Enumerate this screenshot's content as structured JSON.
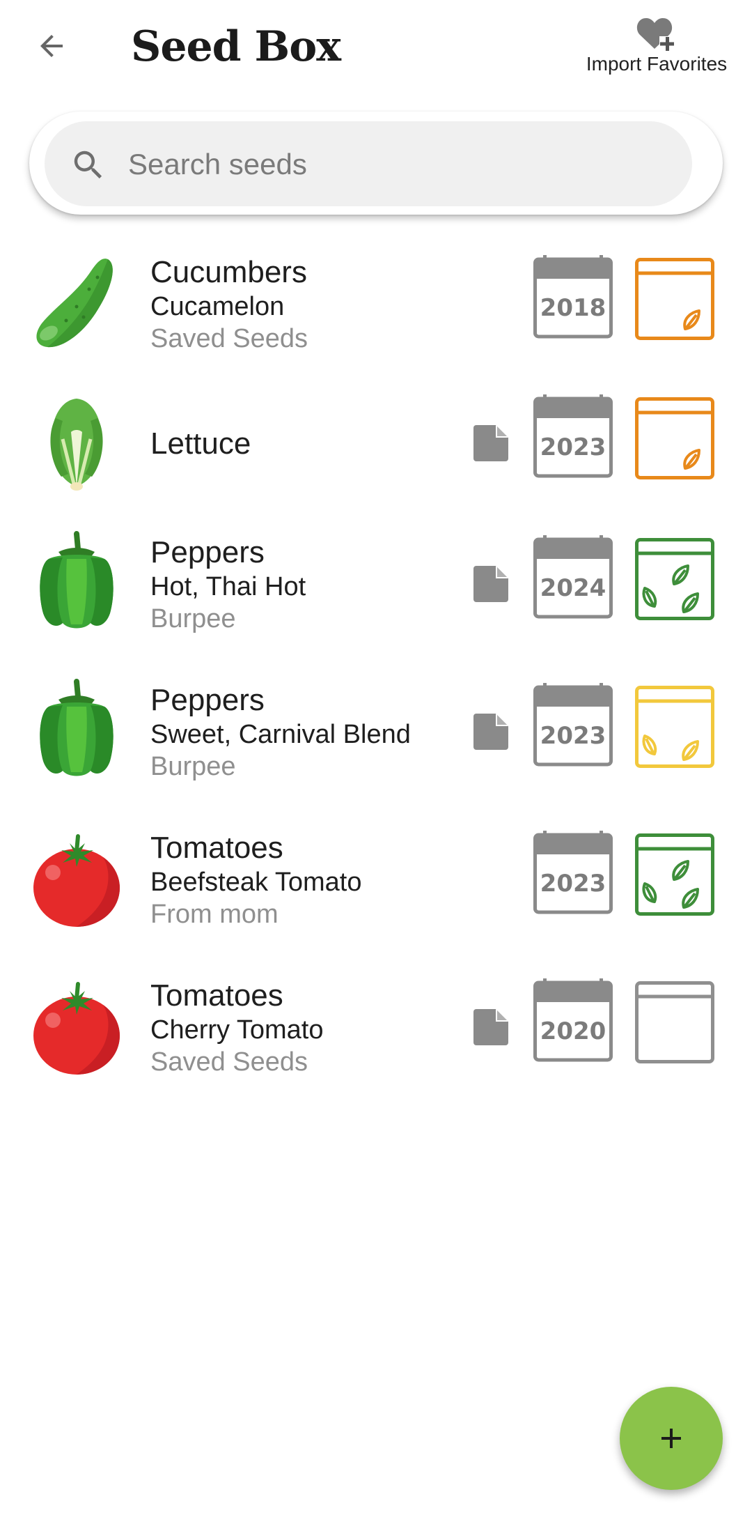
{
  "header": {
    "title": "Seed Box",
    "import_label": "Import Favorites"
  },
  "search": {
    "placeholder": "Search seeds",
    "value": ""
  },
  "seeds": [
    {
      "name": "Cucumbers",
      "variety": "Cucamelon",
      "source": "Saved Seeds",
      "year": "2018",
      "icon": "cucumber-icon",
      "has_note": false,
      "packet_level": "low",
      "packet_color": "#e8891a"
    },
    {
      "name": "Lettuce",
      "variety": "",
      "source": "",
      "year": "2023",
      "icon": "lettuce-icon",
      "has_note": true,
      "packet_level": "low",
      "packet_color": "#e8891a"
    },
    {
      "name": "Peppers",
      "variety": "Hot, Thai Hot",
      "source": "Burpee",
      "year": "2024",
      "icon": "pepper-icon",
      "has_note": true,
      "packet_level": "full",
      "packet_color": "#3e8e3a"
    },
    {
      "name": "Peppers",
      "variety": "Sweet, Carnival Blend",
      "source": "Burpee",
      "year": "2023",
      "icon": "pepper-icon",
      "has_note": true,
      "packet_level": "medium",
      "packet_color": "#f2c83c"
    },
    {
      "name": "Tomatoes",
      "variety": "Beefsteak Tomato",
      "source": "From mom",
      "year": "2023",
      "icon": "tomato-icon",
      "has_note": false,
      "packet_level": "full",
      "packet_color": "#3e8e3a"
    },
    {
      "name": "Tomatoes",
      "variety": "Cherry Tomato",
      "source": "Saved Seeds",
      "year": "2020",
      "icon": "tomato-icon",
      "has_note": true,
      "packet_level": "empty",
      "packet_color": "#8f8f8f"
    }
  ],
  "fab": {
    "icon": "plus-icon"
  },
  "colors": {
    "fab": "#8bc34a",
    "muted": "#8f8f8f"
  }
}
